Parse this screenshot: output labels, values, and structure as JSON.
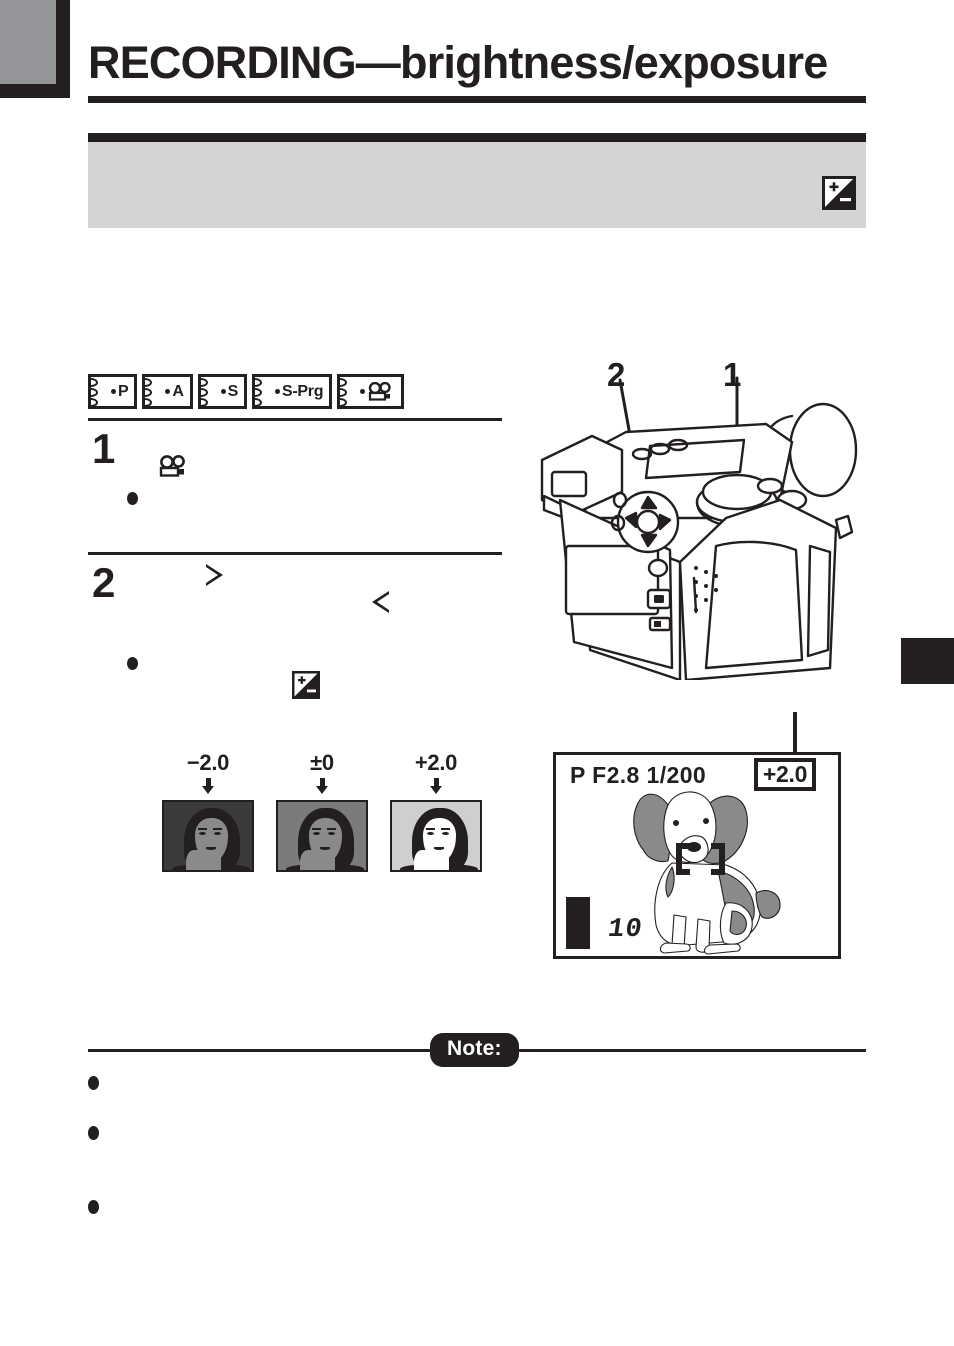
{
  "page": {
    "title": "RECORDING—brightness/exposure",
    "section_heading": "",
    "section_icon": "exposure-compensation-icon"
  },
  "mode_badges": [
    {
      "label": "P",
      "icon": ""
    },
    {
      "label": "A",
      "icon": ""
    },
    {
      "label": "S",
      "icon": ""
    },
    {
      "label": "S-Prg",
      "icon": ""
    },
    {
      "label": "",
      "icon": "movie-camera-icon"
    }
  ],
  "steps": [
    {
      "number": "1",
      "text": "",
      "icon": "movie-camera-icon",
      "bullet_text": ""
    },
    {
      "number": "2",
      "text": "",
      "icons": [
        "arrow-right-icon",
        "arrow-left-icon",
        "exposure-compensation-icon"
      ],
      "bullet_text": ""
    }
  ],
  "exposure_examples": [
    {
      "value": "−2.0",
      "arrow": "arrow-down-icon",
      "tone": "dark"
    },
    {
      "value": "±0",
      "arrow": "arrow-down-icon",
      "tone": "medium"
    },
    {
      "value": "+2.0",
      "arrow": "arrow-down-icon",
      "tone": "light"
    }
  ],
  "lcd": {
    "mode": "P",
    "aperture": "F2.8",
    "shutter": "1/200",
    "status_line": "P  F2.8  1/200",
    "exposure_value": "+2.0",
    "frames_remaining": "10",
    "battery_icon": "battery-full-icon",
    "af_brackets": "af-bracket-icon",
    "subject": "dog-photo"
  },
  "camera_callouts": [
    {
      "number": "2",
      "target": "four-way-pad"
    },
    {
      "number": "1",
      "target": "mode-dial"
    }
  ],
  "note": {
    "label": "Note:",
    "bullets": [
      "",
      "",
      ""
    ]
  },
  "colors": {
    "ink": "#231f20",
    "band_gray": "#d4d4d4",
    "corner_gray": "#939598",
    "photo_dark": "#3a3a3a",
    "photo_medium": "#7b7b7b",
    "photo_light": "#cfcfcf",
    "dog_gray": "#8a8a8a"
  }
}
